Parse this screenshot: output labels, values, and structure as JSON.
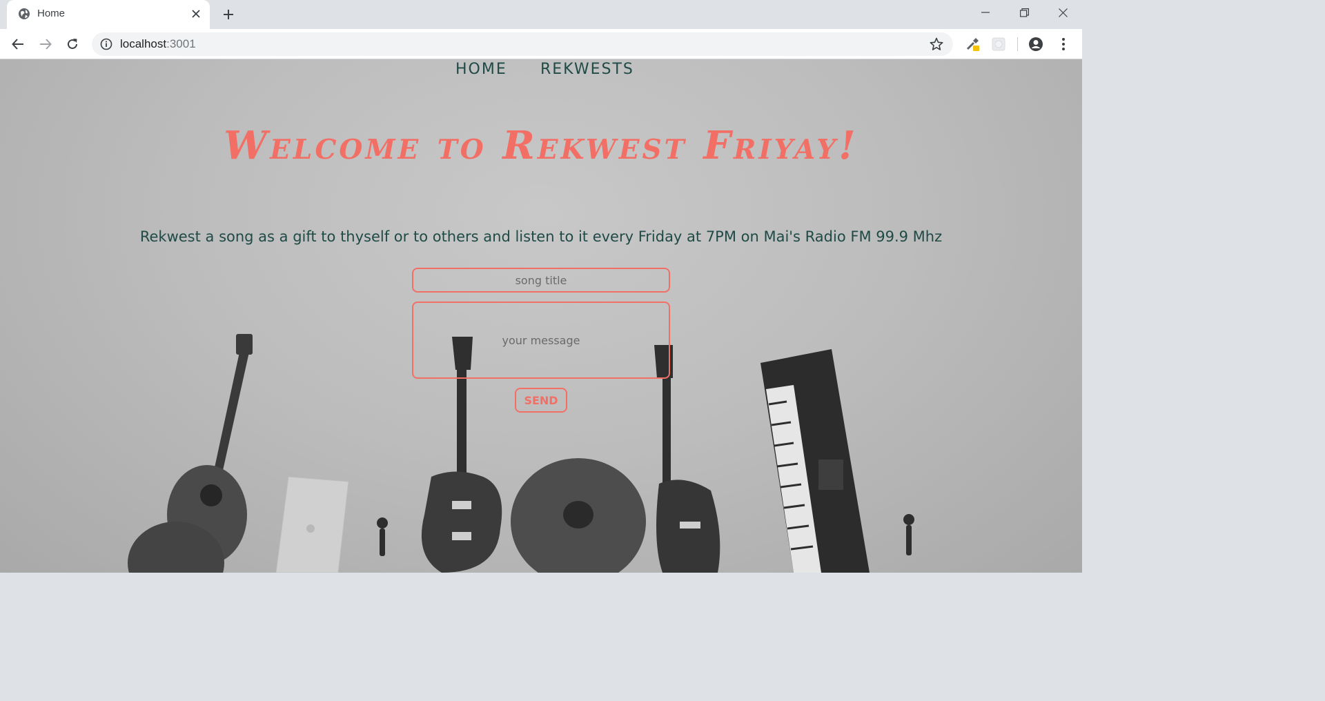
{
  "browser": {
    "tab_title": "Home",
    "new_tab": "+",
    "url_host": "localhost",
    "url_port": ":3001"
  },
  "nav": {
    "home": "HOME",
    "rekwests": "REKWESTS"
  },
  "hero": {
    "title": "Welcome to Rekwest Friyay!",
    "tagline": "Rekwest a song as a gift to thyself or to others and listen to it every Friday at 7PM on Mai's Radio FM 99.9 Mhz"
  },
  "form": {
    "song_placeholder": "song title",
    "message_placeholder": "your message",
    "send_label": "SEND"
  },
  "colors": {
    "accent": "#f26f65",
    "nav_text": "#1f4a46"
  },
  "icons": {
    "tab_favicon": "globe-icon",
    "back": "arrow-left-icon",
    "forward": "arrow-right-icon",
    "reload": "reload-icon",
    "info": "info-icon",
    "bookmark": "star-icon",
    "profile": "account-icon",
    "menu": "kebab-menu-icon"
  }
}
